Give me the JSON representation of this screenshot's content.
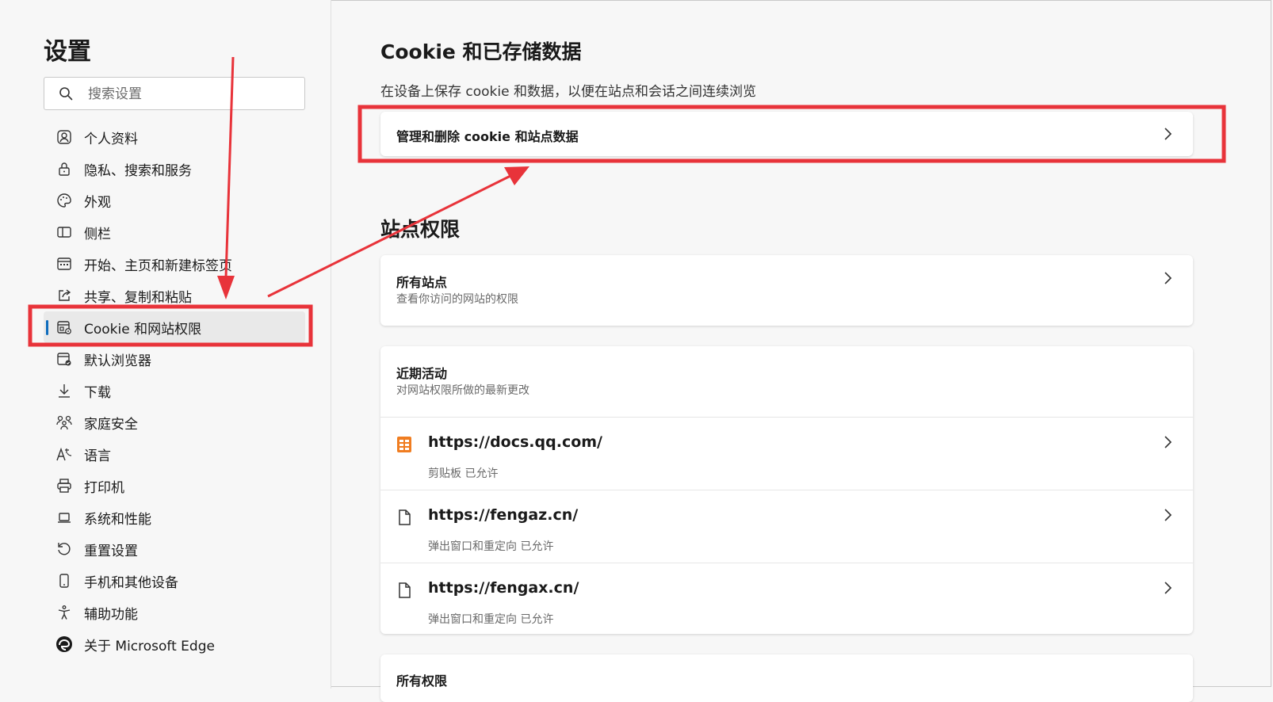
{
  "sidebar": {
    "title": "设置",
    "search_placeholder": "搜索设置",
    "items": [
      {
        "label": "个人资料",
        "icon": "profile-icon"
      },
      {
        "label": "隐私、搜索和服务",
        "icon": "lock-icon"
      },
      {
        "label": "外观",
        "icon": "palette-icon"
      },
      {
        "label": "侧栏",
        "icon": "sidebar-panel-icon"
      },
      {
        "label": "开始、主页和新建标签页",
        "icon": "home-tabs-icon"
      },
      {
        "label": "共享、复制和粘贴",
        "icon": "share-icon"
      },
      {
        "label": "Cookie 和网站权限",
        "icon": "cookie-site-icon",
        "active": true
      },
      {
        "label": "默认浏览器",
        "icon": "default-browser-icon"
      },
      {
        "label": "下载",
        "icon": "download-icon"
      },
      {
        "label": "家庭安全",
        "icon": "family-icon"
      },
      {
        "label": "语言",
        "icon": "language-icon"
      },
      {
        "label": "打印机",
        "icon": "printer-icon"
      },
      {
        "label": "系统和性能",
        "icon": "laptop-icon"
      },
      {
        "label": "重置设置",
        "icon": "reset-icon"
      },
      {
        "label": "手机和其他设备",
        "icon": "phone-icon"
      },
      {
        "label": "辅助功能",
        "icon": "accessibility-icon"
      },
      {
        "label": "关于 Microsoft Edge",
        "icon": "edge-logo-icon"
      }
    ]
  },
  "main": {
    "cookie_section": {
      "title": "Cookie 和已存储数据",
      "description": "在设备上保存 cookie 和数据，以便在站点和会话之间连续浏览",
      "manage_label": "管理和删除 cookie 和站点数据"
    },
    "permissions_section": {
      "title": "站点权限",
      "all_sites": {
        "title": "所有站点",
        "subtitle": "查看你访问的网站的权限"
      },
      "recent": {
        "title": "近期活动",
        "subtitle": "对网站权限所做的最新更改",
        "sites": [
          {
            "url": "https://docs.qq.com/",
            "detail": "剪贴板 已允许",
            "icon": "qq-docs-icon"
          },
          {
            "url": "https://fengaz.cn/",
            "detail": "弹出窗口和重定向 已允许",
            "icon": "page-icon"
          },
          {
            "url": "https://fengax.cn/",
            "detail": "弹出窗口和重定向 已允许",
            "icon": "page-icon"
          }
        ]
      },
      "all_permissions_title": "所有权限"
    }
  },
  "annotation": {
    "highlight_color": "#e8333a"
  }
}
